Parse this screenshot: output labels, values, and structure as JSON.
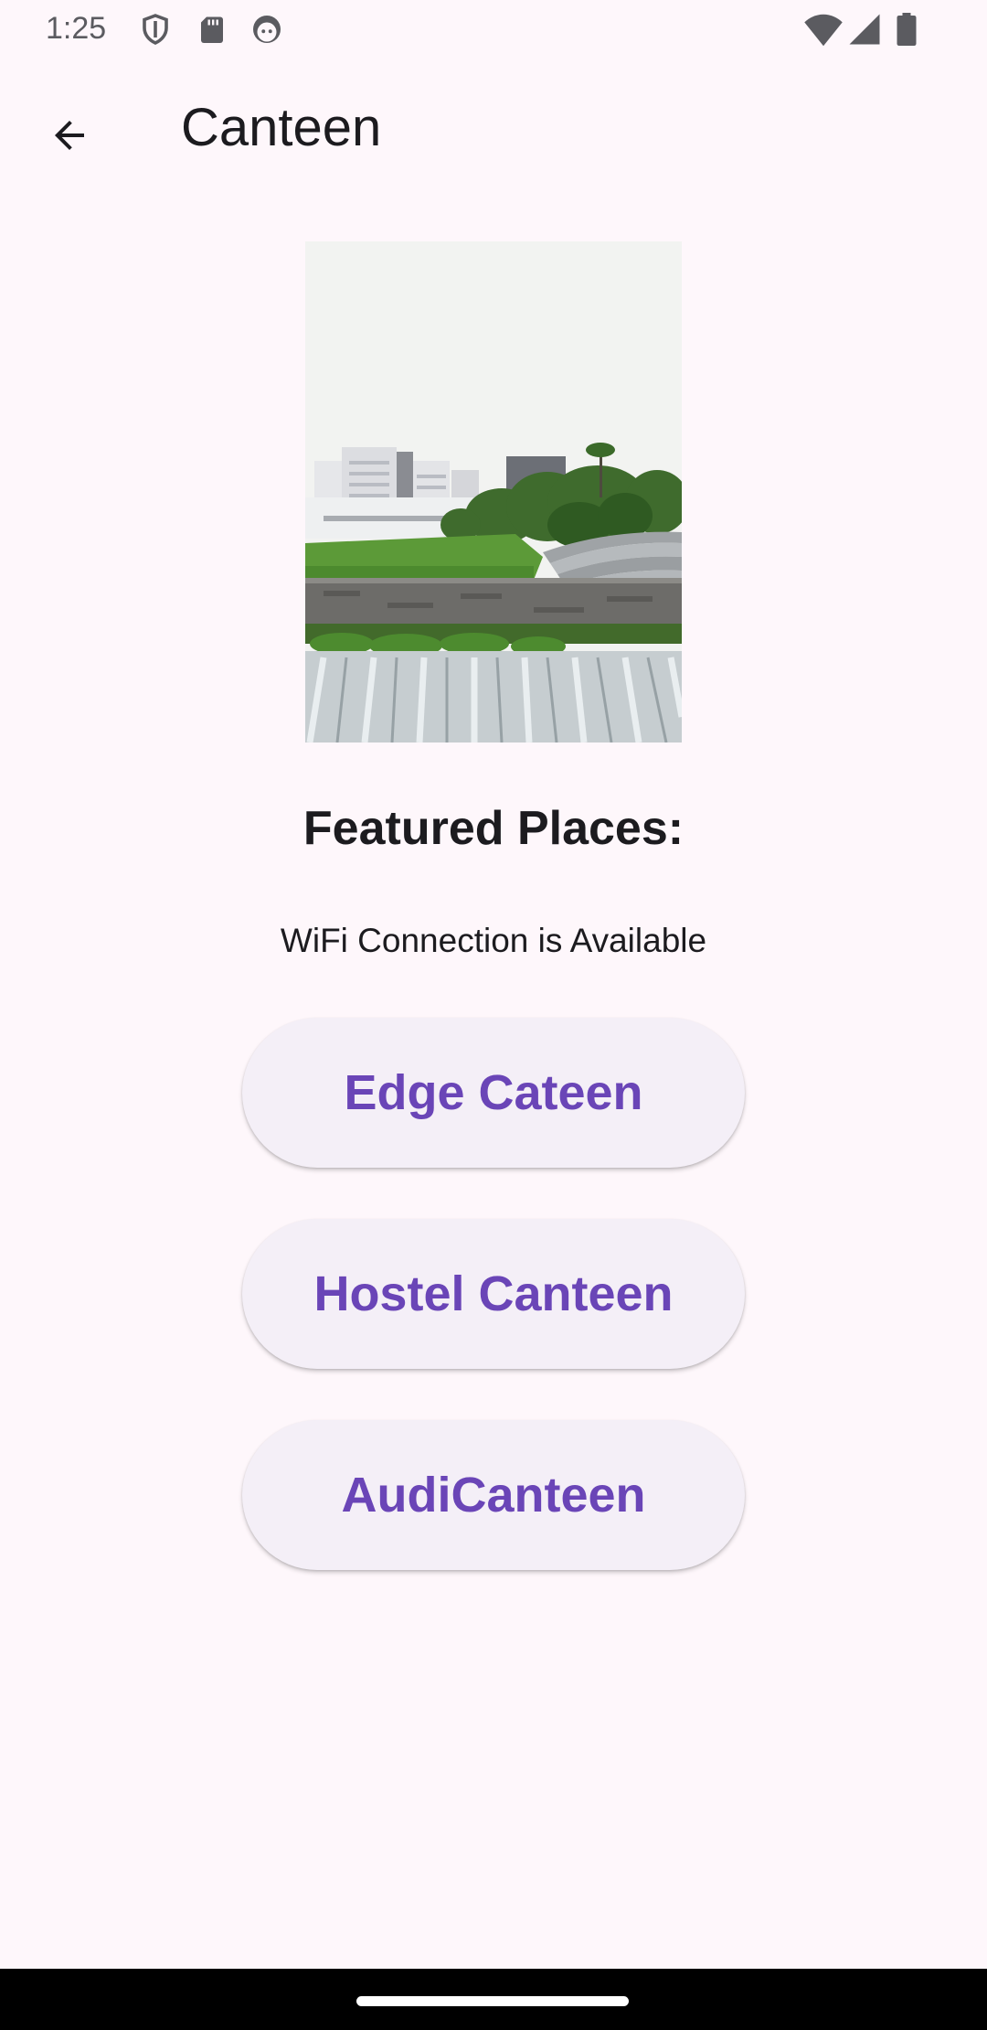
{
  "status_bar": {
    "time": "1:25",
    "left_icons": [
      "shield-icon",
      "sd-card-icon",
      "android-head-icon"
    ],
    "right_icons": [
      "wifi-icon",
      "cell-signal-icon",
      "battery-icon"
    ]
  },
  "app_bar": {
    "back_icon": "arrow-back-icon",
    "title": "Canteen"
  },
  "main": {
    "section_title": "Featured Places:",
    "wifi_status": "WiFi Connection is Available",
    "buttons": [
      {
        "label": "Edge Cateen"
      },
      {
        "label": "Hostel Canteen"
      },
      {
        "label": "AudiCanteen"
      }
    ]
  },
  "colors": {
    "background": "#fef7fb",
    "button_background": "#f4eff7",
    "button_text": "#6a45b7",
    "text_primary": "#1c1b1f",
    "nav_bar": "#000000"
  }
}
